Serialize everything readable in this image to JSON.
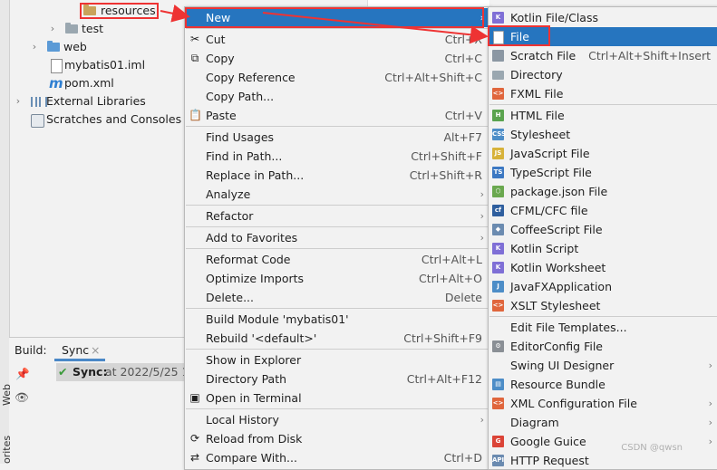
{
  "tree": {
    "items": [
      {
        "label": "resources"
      },
      {
        "label": "test"
      },
      {
        "label": "web"
      },
      {
        "label": "mybatis01.iml"
      },
      {
        "label": "pom.xml"
      },
      {
        "label": "External Libraries"
      },
      {
        "label": "Scratches and Consoles"
      }
    ]
  },
  "build": {
    "tab_build": "Build:",
    "tab_sync": "Sync",
    "close_glyph": "×",
    "sync_label": "Sync:",
    "sync_time": "at 2022/5/25 1 ",
    "side_web": "Web",
    "side_fav": "orites"
  },
  "menu1": {
    "items": [
      {
        "label": "New",
        "shortcut": "",
        "submenu": true,
        "icon": "",
        "selected": true
      },
      {
        "label": "Cut",
        "shortcut": "Ctrl+X",
        "icon": "✂"
      },
      {
        "label": "Copy",
        "shortcut": "Ctrl+C",
        "icon": "⧉"
      },
      {
        "label": "Copy Reference",
        "shortcut": "Ctrl+Alt+Shift+C",
        "icon": ""
      },
      {
        "label": "Copy Path...",
        "shortcut": "",
        "icon": ""
      },
      {
        "label": "Paste",
        "shortcut": "Ctrl+V",
        "icon": "📋"
      },
      {
        "label": "Find Usages",
        "shortcut": "Alt+F7",
        "icon": ""
      },
      {
        "label": "Find in Path...",
        "shortcut": "Ctrl+Shift+F",
        "icon": ""
      },
      {
        "label": "Replace in Path...",
        "shortcut": "Ctrl+Shift+R",
        "icon": ""
      },
      {
        "label": "Analyze",
        "shortcut": "",
        "submenu": true,
        "icon": ""
      },
      {
        "label": "Refactor",
        "shortcut": "",
        "submenu": true,
        "icon": ""
      },
      {
        "label": "Add to Favorites",
        "shortcut": "",
        "submenu": true,
        "icon": ""
      },
      {
        "label": "Reformat Code",
        "shortcut": "Ctrl+Alt+L",
        "icon": ""
      },
      {
        "label": "Optimize Imports",
        "shortcut": "Ctrl+Alt+O",
        "icon": ""
      },
      {
        "label": "Delete...",
        "shortcut": "Delete",
        "icon": ""
      },
      {
        "label": "Build Module 'mybatis01'",
        "shortcut": "",
        "icon": ""
      },
      {
        "label": "Rebuild '<default>'",
        "shortcut": "Ctrl+Shift+F9",
        "icon": ""
      },
      {
        "label": "Show in Explorer",
        "shortcut": "",
        "icon": ""
      },
      {
        "label": "Directory Path",
        "shortcut": "Ctrl+Alt+F12",
        "icon": ""
      },
      {
        "label": "Open in Terminal",
        "shortcut": "",
        "icon": "▣"
      },
      {
        "label": "Local History",
        "shortcut": "",
        "submenu": true,
        "icon": ""
      },
      {
        "label": "Reload from Disk",
        "shortcut": "",
        "icon": "⟳"
      },
      {
        "label": "Compare With...",
        "shortcut": "Ctrl+D",
        "icon": "⇄"
      }
    ]
  },
  "menu2": {
    "items": [
      {
        "label": "Kotlin File/Class",
        "icon": "kotlin",
        "badge": "K",
        "color": "#7f6fd6"
      },
      {
        "label": "File",
        "icon": "file",
        "badge": "",
        "color": "#9aa0a6",
        "selected": true
      },
      {
        "label": "Scratch File",
        "shortcut": "Ctrl+Alt+Shift+Insert",
        "icon": "scratch",
        "badge": "",
        "color": "#8b97a3"
      },
      {
        "label": "Directory",
        "icon": "folder",
        "badge": "",
        "color": "#9aa7b0"
      },
      {
        "label": "FXML File",
        "icon": "fxml",
        "badge": "<>",
        "color": "#e0663d"
      },
      {
        "label": "HTML File",
        "icon": "html",
        "badge": "H",
        "color": "#5aa34e"
      },
      {
        "label": "Stylesheet",
        "icon": "css",
        "badge": "CSS",
        "color": "#4d8dc7"
      },
      {
        "label": "JavaScript File",
        "icon": "js",
        "badge": "JS",
        "color": "#d7b23a"
      },
      {
        "label": "TypeScript File",
        "icon": "ts",
        "badge": "TS",
        "color": "#3c78c2"
      },
      {
        "label": "package.json File",
        "icon": "package",
        "badge": "⬡",
        "color": "#6aa84f"
      },
      {
        "label": "CFML/CFC file",
        "icon": "cfml",
        "badge": "cf",
        "color": "#2e5e9e"
      },
      {
        "label": "CoffeeScript File",
        "icon": "coffee",
        "badge": "◆",
        "color": "#6b8bb0"
      },
      {
        "label": "Kotlin Script",
        "icon": "kotlin",
        "badge": "K",
        "color": "#7f6fd6"
      },
      {
        "label": "Kotlin Worksheet",
        "icon": "kotlin",
        "badge": "K",
        "color": "#7f6fd6"
      },
      {
        "label": "JavaFXApplication",
        "icon": "javafx",
        "badge": "J",
        "color": "#4d8dc7"
      },
      {
        "label": "XSLT Stylesheet",
        "icon": "xslt",
        "badge": "<>",
        "color": "#e0663d"
      },
      {
        "label": "Edit File Templates...",
        "icon": "",
        "badge": "",
        "color": ""
      },
      {
        "label": "EditorConfig File",
        "icon": "gear",
        "badge": "⚙",
        "color": "#8a8f95"
      },
      {
        "label": "Swing UI Designer",
        "icon": "",
        "badge": "",
        "color": "",
        "submenu": true
      },
      {
        "label": "Resource Bundle",
        "icon": "bundle",
        "badge": "▤",
        "color": "#4d8dc7"
      },
      {
        "label": "XML Configuration File",
        "icon": "xml",
        "badge": "<>",
        "color": "#e0663d",
        "submenu": true
      },
      {
        "label": "Diagram",
        "icon": "",
        "badge": "",
        "color": "",
        "submenu": true
      },
      {
        "label": "Google Guice",
        "icon": "google",
        "badge": "G",
        "color": "#db4437",
        "submenu": true
      },
      {
        "label": "HTTP Request",
        "icon": "api",
        "badge": "API",
        "color": "#6b8bb0"
      }
    ]
  },
  "watermark": "CSDN @qwsn",
  "colors": {
    "selection": "#2675bf",
    "highlight": "#e33333"
  }
}
